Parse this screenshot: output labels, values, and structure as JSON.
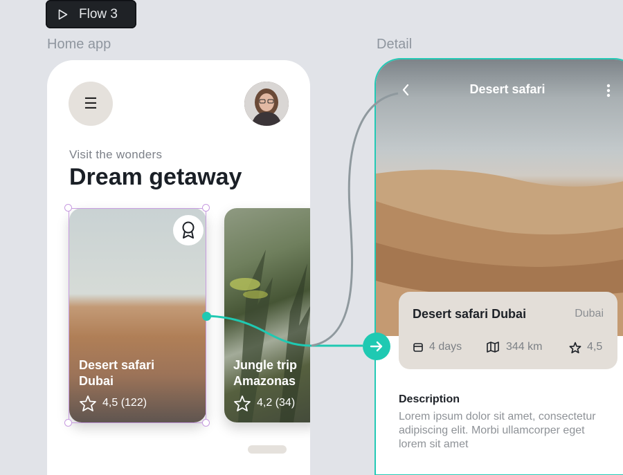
{
  "flow_button": {
    "label": "Flow 3",
    "icon": "play-icon"
  },
  "frames": {
    "home_label": "Home app",
    "detail_label": "Detail"
  },
  "home": {
    "menu_icon": "menu-icon",
    "subtitle": "Visit the wonders",
    "title": "Dream getaway",
    "cards": [
      {
        "title_line1": "Desert safari",
        "title_line2": "Dubai",
        "rating": "4,5 (122)",
        "badge_icon": "award-icon"
      },
      {
        "title_line1": "Jungle trip",
        "title_line2": "Amazonas",
        "rating": "4,2 (34)"
      }
    ]
  },
  "detail": {
    "back_icon": "chevron-left-icon",
    "title": "Desert safari",
    "more_icon": "more-vertical-icon",
    "info": {
      "name": "Desert safari Dubai",
      "location": "Dubai",
      "duration": "4 days",
      "distance": "344 km",
      "rating": "4,5"
    },
    "description_title": "Description",
    "description_body": "Lorem ipsum dolor sit amet, consectetur adipiscing elit. Morbi ullamcorper eget lorem sit amet"
  },
  "colors": {
    "accent": "#1fc9b2",
    "selection": "#c79be0",
    "background": "#e1e3e8"
  }
}
